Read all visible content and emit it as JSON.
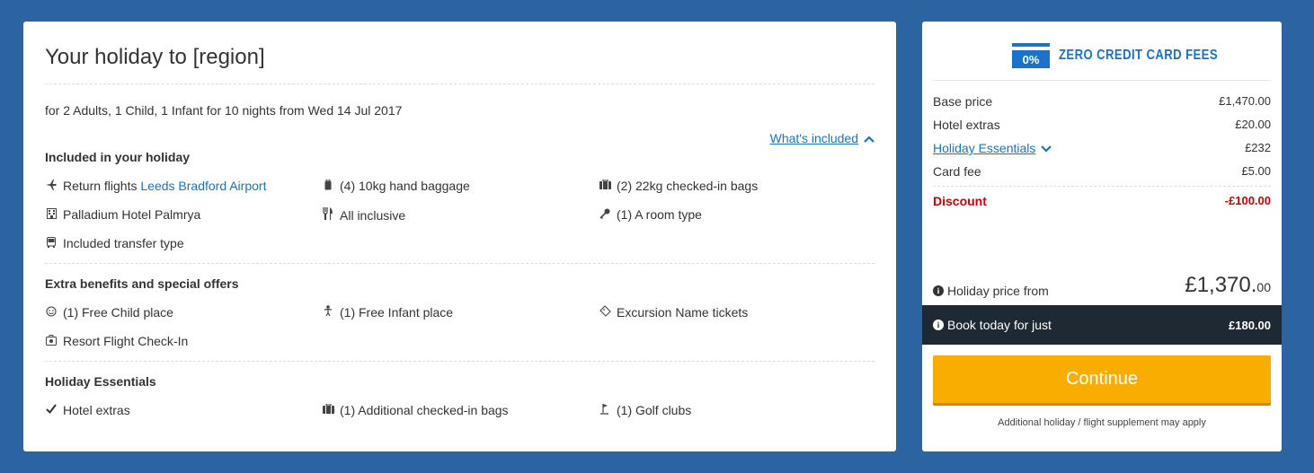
{
  "summary": {
    "title": "Your holiday to [region]",
    "subtitle": "for 2 Adults, 1 Child, 1 Infant for 10 nights from Wed 14 Jul 2017",
    "whats_included": "What's included",
    "sections": {
      "included": {
        "heading": "Included in your holiday",
        "flights_prefix": "Return flights",
        "airport": "Leeds Bradford Airport",
        "hand_baggage": "(4) 10kg hand baggage",
        "checked_bags": "(2) 22kg checked-in bags",
        "hotel": "Palladium Hotel Palmrya",
        "board": "All inclusive",
        "room": "(1) A room type",
        "transfer": "Included transfer type"
      },
      "benefits": {
        "heading": "Extra benefits and special offers",
        "child_place": "(1) Free Child place",
        "infant_place": "(1) Free Infant place",
        "excursion": "Excursion Name tickets",
        "checkin": "Resort Flight Check-In"
      },
      "essentials": {
        "heading": "Holiday Essentials",
        "hotel_extras": "Hotel extras",
        "additional_bags": "(1) Additional checked-in bags",
        "golf": "(1) Golf clubs"
      }
    }
  },
  "pricing": {
    "badge_pct": "0%",
    "badge_text": "ZERO CREDIT CARD FEES",
    "rows": [
      {
        "label": "Base price",
        "value": "£1,470.00"
      },
      {
        "label": "Hotel extras",
        "value": "£20.00"
      },
      {
        "label": "Holiday Essentials",
        "value": "£232"
      },
      {
        "label": "Card fee",
        "value": "£5.00"
      }
    ],
    "discount": {
      "label": "Discount",
      "value": "-£100.00"
    },
    "total_label": "Holiday price from",
    "total_main": "£1,370.",
    "total_dec": "00",
    "today_label": "Book today for just",
    "today_value": "£180.00",
    "continue_label": "Continue",
    "supplement_note": "Additional holiday / flight supplement may apply"
  },
  "colors": {
    "background": "#2c64a2",
    "accent": "#1a73c8",
    "cta": "#f8ad00",
    "discount": "#cc0000",
    "dark_bar": "#1f2933"
  }
}
